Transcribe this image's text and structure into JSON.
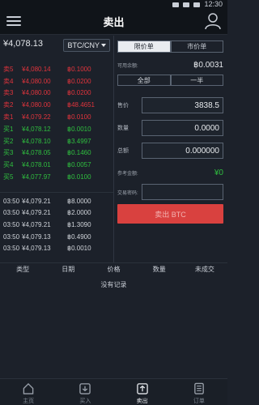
{
  "status": {
    "time": "12:30"
  },
  "header": {
    "title": "卖出"
  },
  "market": {
    "last_price": "¥4,078.13",
    "pair": "BTC/CNY"
  },
  "asks": [
    {
      "label": "卖5",
      "price": "¥4,080.14",
      "amount": "฿0.1000"
    },
    {
      "label": "卖4",
      "price": "¥4,080.00",
      "amount": "฿0.0200"
    },
    {
      "label": "卖3",
      "price": "¥4,080.00",
      "amount": "฿0.0200"
    },
    {
      "label": "卖2",
      "price": "¥4,080.00",
      "amount": "฿48.4651"
    },
    {
      "label": "卖1",
      "price": "¥4,079.22",
      "amount": "฿0.0100"
    }
  ],
  "bids": [
    {
      "label": "买1",
      "price": "¥4,078.12",
      "amount": "฿0.0010"
    },
    {
      "label": "买2",
      "price": "¥4,078.10",
      "amount": "฿3.4997"
    },
    {
      "label": "买3",
      "price": "¥4,078.05",
      "amount": "฿0.1460"
    },
    {
      "label": "买4",
      "price": "¥4,078.01",
      "amount": "฿0.0057"
    },
    {
      "label": "买5",
      "price": "¥4,077.97",
      "amount": "฿0.0100"
    }
  ],
  "trades": [
    {
      "time": "03:50",
      "price": "¥4,079.21",
      "amount": "฿8.0000"
    },
    {
      "time": "03:50",
      "price": "¥4,079.21",
      "amount": "฿2.0000"
    },
    {
      "time": "03:50",
      "price": "¥4,079.21",
      "amount": "฿1.3090"
    },
    {
      "time": "03:50",
      "price": "¥4,079.13",
      "amount": "฿0.4900"
    },
    {
      "time": "03:50",
      "price": "¥4,079.13",
      "amount": "฿0.0010"
    }
  ],
  "form": {
    "tab_limit": "限价单",
    "tab_market": "市价单",
    "available_label": "可用余额:",
    "available_value": "฿0.0031",
    "btn_all": "全部",
    "btn_half": "一半",
    "price_label": "售价",
    "price_value": "3838.5",
    "qty_label": "数量",
    "qty_value": "0.0000",
    "total_label": "总额",
    "total_value": "0.000000",
    "ref_label": "参考金额:",
    "ref_value": "¥0",
    "pwd_label": "交易密码:",
    "sell_label": "卖出 BTC"
  },
  "orders": {
    "headers": [
      "类型",
      "日期",
      "价格",
      "数量",
      "未成交"
    ],
    "empty_text": "没有记录"
  },
  "nav": [
    {
      "label": "主页",
      "icon": "home-icon"
    },
    {
      "label": "买入",
      "icon": "buy-icon"
    },
    {
      "label": "卖出",
      "icon": "sell-icon"
    },
    {
      "label": "订单",
      "icon": "orders-icon"
    }
  ]
}
